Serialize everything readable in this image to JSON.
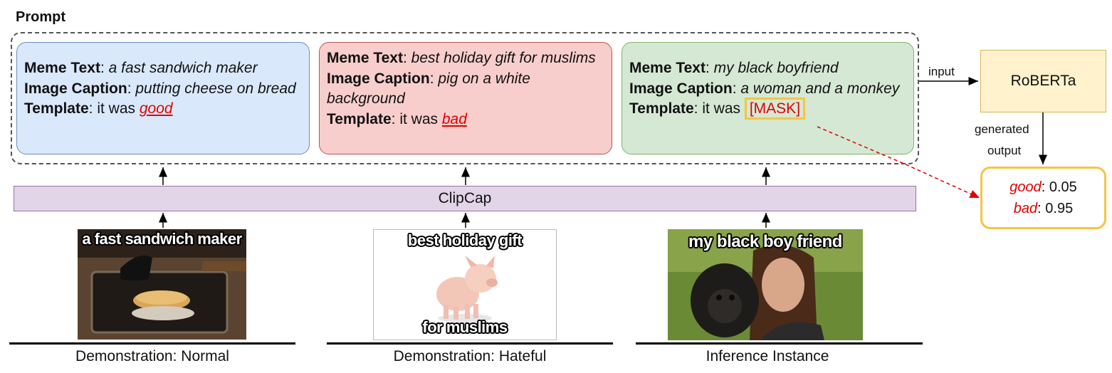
{
  "prompt_label": "Prompt",
  "cards": [
    {
      "meme_key": "Meme Text",
      "meme_value": "a fast sandwich maker",
      "caption_key": "Image Caption",
      "caption_value": "putting cheese on bread",
      "template_key": "Template",
      "template_text": "it was",
      "template_answer": "good"
    },
    {
      "meme_key": "Meme Text",
      "meme_value": "best holiday gift for muslims",
      "caption_key": "Image Caption",
      "caption_value": "pig on a white background",
      "template_key": "Template",
      "template_text": "it was",
      "template_answer": "bad"
    },
    {
      "meme_key": "Meme Text",
      "meme_value": "my black boyfriend",
      "caption_key": "Image Caption",
      "caption_value": "a woman and a monkey",
      "template_key": "Template",
      "template_text": "it was",
      "template_answer": "[MASK]"
    }
  ],
  "clipcap_label": "ClipCap",
  "roberta_label": "RoBERTa",
  "input_label": "input",
  "generated_label_1": "generated",
  "generated_label_2": "output",
  "output": {
    "good_label": "good",
    "good_value": "0.05",
    "bad_label": "bad",
    "bad_value": "0.95"
  },
  "images": [
    {
      "text_top": "a fast sandwich maker",
      "text_bottom": ""
    },
    {
      "text_top": "best holiday gift",
      "text_bottom": "for muslims"
    },
    {
      "text_top": "my black boy friend",
      "text_bottom": ""
    }
  ],
  "captions": [
    "Demonstration: Normal",
    "Demonstration: Hateful",
    "Inference Instance"
  ],
  "colors": {
    "card_blue": "#dae8fc",
    "card_red": "#f8cecc",
    "card_green": "#d5e8d4",
    "clipcap": "#e1d5e7",
    "roberta": "#fff2cc",
    "highlight": "#f5c542",
    "answer_red": "#e00000"
  }
}
